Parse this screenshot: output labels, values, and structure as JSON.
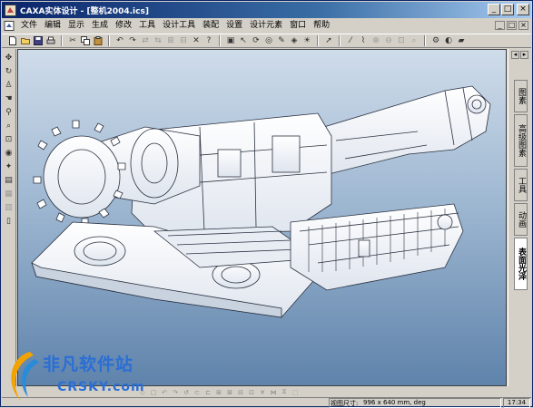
{
  "window": {
    "title": "CAXA实体设计 - [整机2004.ics]",
    "title_buttons": [
      "_",
      "□",
      "×"
    ]
  },
  "menubar": {
    "items": [
      "文件",
      "编辑",
      "显示",
      "生成",
      "修改",
      "工具",
      "设计工具",
      "装配",
      "设置",
      "设计元素",
      "窗口",
      "帮助"
    ],
    "right_buttons": [
      "_",
      "□",
      "×"
    ]
  },
  "right_panel": {
    "tabs": [
      "图素",
      "高级图素",
      "工具",
      "动画",
      "表面光泽"
    ],
    "active_tab": "表面光泽"
  },
  "status": {
    "label": "视图尺寸:",
    "value": "996 x 640  mm, deg",
    "time": "17:34"
  },
  "watermark": {
    "line1": "非凡软件站",
    "line2": "CRSKY.com"
  },
  "colors": {
    "titlebar_start": "#0a246a",
    "viewport_top": "#cfdcea",
    "viewport_bottom": "#5f83ab",
    "watermark": "#2a6ed4"
  },
  "icons": {
    "toolbar": [
      "new-icon",
      "open-icon",
      "save-icon",
      "print-icon",
      "cut-icon",
      "copy-icon",
      "paste-icon",
      "undo-icon",
      "redo-icon",
      "help-icon",
      "select-icon",
      "rotate-icon",
      "pan-icon",
      "zoom-icon",
      "fit-icon",
      "render-icon"
    ],
    "left": [
      "move-icon",
      "rotate-icon",
      "orbit-icon",
      "walk-icon",
      "zoom-icon",
      "zoom-window-icon",
      "fit-icon",
      "look-at-icon",
      "light-icon",
      "camera-icon",
      "section-icon",
      "measure-icon"
    ]
  }
}
